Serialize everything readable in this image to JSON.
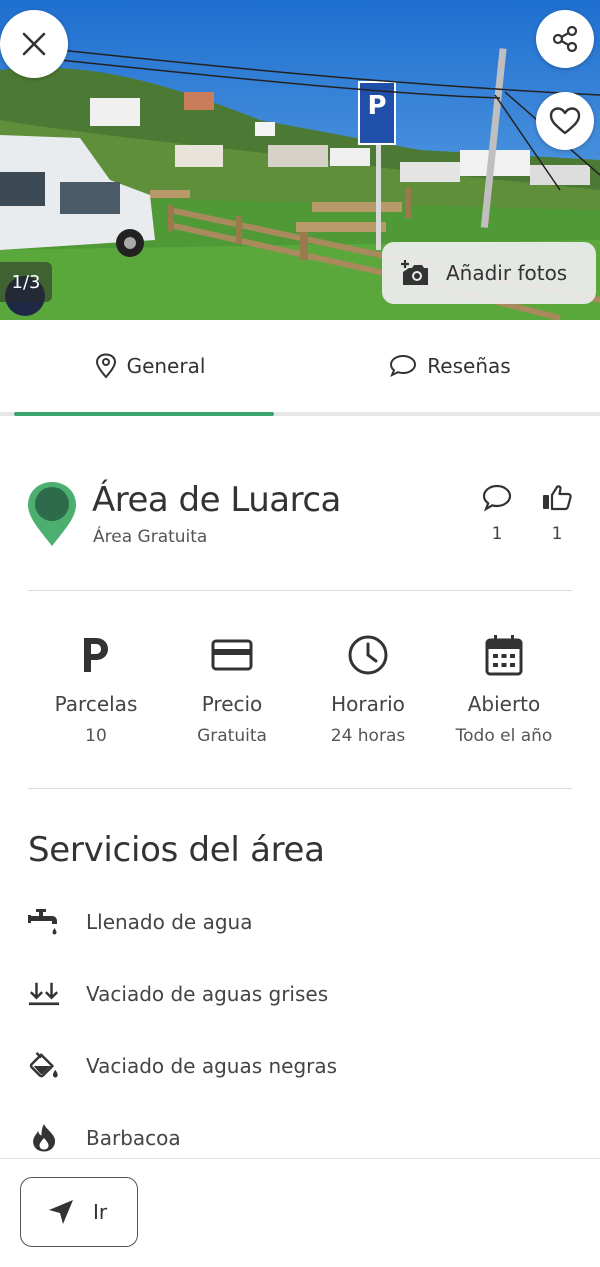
{
  "gallery": {
    "counter": "1/3",
    "add_photos_label": "Añadir fotos",
    "parking_sign_letter": "P"
  },
  "tabs": [
    {
      "label": "General",
      "icon": "location-pin-icon",
      "active": true
    },
    {
      "label": "Reseñas",
      "icon": "chat-bubble-icon",
      "active": false
    }
  ],
  "place": {
    "name": "Área de Luarca",
    "type": "Área Gratuita",
    "comments_count": "1",
    "likes_count": "1"
  },
  "info": [
    {
      "label": "Parcelas",
      "value": "10",
      "icon": "parking-icon"
    },
    {
      "label": "Precio",
      "value": "Gratuita",
      "icon": "credit-card-icon"
    },
    {
      "label": "Horario",
      "value": "24 horas",
      "icon": "clock-icon"
    },
    {
      "label": "Abierto",
      "value": "Todo el año",
      "icon": "calendar-icon"
    }
  ],
  "services": {
    "title": "Servicios del área",
    "items": [
      {
        "label": "Llenado de agua",
        "icon": "water-tap-icon"
      },
      {
        "label": "Vaciado de aguas grises",
        "icon": "double-down-arrow-icon"
      },
      {
        "label": "Vaciado de aguas negras",
        "icon": "paint-bucket-drop-icon"
      },
      {
        "label": "Barbacoa",
        "icon": "fire-icon"
      }
    ]
  },
  "action": {
    "go_label": "Ir"
  },
  "colors": {
    "accent": "#3aa56a",
    "pin": "#4caf70",
    "pin_dark": "#2e6b4a",
    "sky": "#2e7fd6"
  }
}
